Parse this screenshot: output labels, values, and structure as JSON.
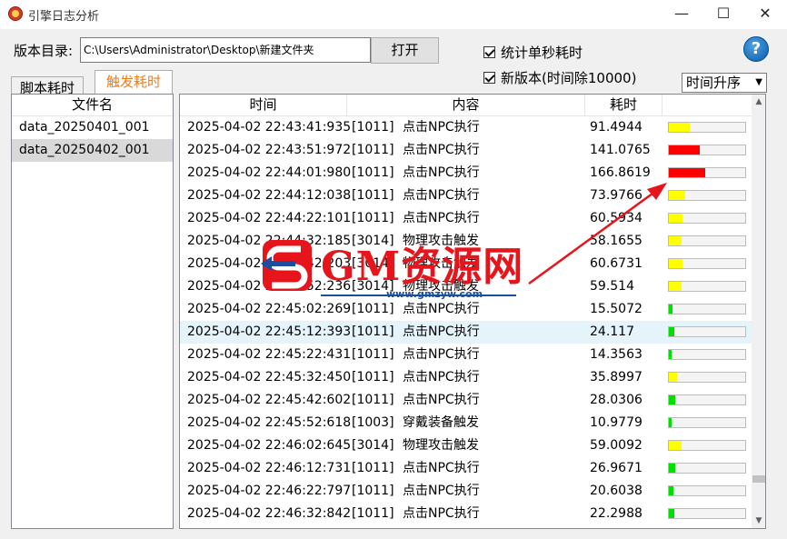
{
  "window": {
    "title": "引擎日志分析",
    "minimize": "—",
    "maximize": "☐",
    "close": "✕"
  },
  "toolbar": {
    "dir_label": "版本目录:",
    "dir_value": "C:\\Users\\Administrator\\Desktop\\新建文件夹",
    "open_label": "打开",
    "stat_per_second": "统计单秒耗时",
    "new_version": "新版本(时间除10000)",
    "help": "?"
  },
  "sort": {
    "value": "时间升序"
  },
  "tabs": [
    {
      "label": "脚本耗时",
      "active": false
    },
    {
      "label": "触发耗时",
      "active": true
    }
  ],
  "file_list": {
    "header": "文件名",
    "items": [
      "data_20250401_001",
      "data_20250402_001"
    ],
    "selected_index": 1
  },
  "table": {
    "headers": {
      "time": "时间",
      "content": "内容",
      "duration": "耗时"
    },
    "highlight_index": 9,
    "rows": [
      {
        "time": "2025-04-02 22:43:41:935",
        "code": "[1011]",
        "name": "点击NPC执行",
        "value": "91.4944",
        "bar": 0.27,
        "color": "#ffff00"
      },
      {
        "time": "2025-04-02 22:43:51:972",
        "code": "[1011]",
        "name": "点击NPC执行",
        "value": "141.0765",
        "bar": 0.41,
        "color": "#ff0000"
      },
      {
        "time": "2025-04-02 22:44:01:980",
        "code": "[1011]",
        "name": "点击NPC执行",
        "value": "166.8619",
        "bar": 0.48,
        "color": "#ff0000"
      },
      {
        "time": "2025-04-02 22:44:12:038",
        "code": "[1011]",
        "name": "点击NPC执行",
        "value": "73.9766",
        "bar": 0.22,
        "color": "#ffff00"
      },
      {
        "time": "2025-04-02 22:44:22:101",
        "code": "[1011]",
        "name": "点击NPC执行",
        "value": "60.5934",
        "bar": 0.18,
        "color": "#ffff00"
      },
      {
        "time": "2025-04-02 22:44:32:185",
        "code": "[3014]",
        "name": "物理攻击触发",
        "value": "58.1655",
        "bar": 0.17,
        "color": "#ffff00"
      },
      {
        "time": "2025-04-02 22:44:42:203",
        "code": "[3014]",
        "name": "物理攻击触发",
        "value": "60.6731",
        "bar": 0.18,
        "color": "#ffff00"
      },
      {
        "time": "2025-04-02 22:44:52:236",
        "code": "[3014]",
        "name": "物理攻击触发",
        "value": "59.514",
        "bar": 0.17,
        "color": "#ffff00"
      },
      {
        "time": "2025-04-02 22:45:02:269",
        "code": "[1011]",
        "name": "点击NPC执行",
        "value": "15.5072",
        "bar": 0.05,
        "color": "#00e000"
      },
      {
        "time": "2025-04-02 22:45:12:393",
        "code": "[1011]",
        "name": "点击NPC执行",
        "value": "24.117",
        "bar": 0.07,
        "color": "#00e000"
      },
      {
        "time": "2025-04-02 22:45:22:431",
        "code": "[1011]",
        "name": "点击NPC执行",
        "value": "14.3563",
        "bar": 0.04,
        "color": "#00e000"
      },
      {
        "time": "2025-04-02 22:45:32:450",
        "code": "[1011]",
        "name": "点击NPC执行",
        "value": "35.8997",
        "bar": 0.11,
        "color": "#ffff00"
      },
      {
        "time": "2025-04-02 22:45:42:602",
        "code": "[1011]",
        "name": "点击NPC执行",
        "value": "28.0306",
        "bar": 0.08,
        "color": "#00e000"
      },
      {
        "time": "2025-04-02 22:45:52:618",
        "code": "[1003]",
        "name": "穿戴装备触发",
        "value": "10.9779",
        "bar": 0.03,
        "color": "#00e000"
      },
      {
        "time": "2025-04-02 22:46:02:645",
        "code": "[3014]",
        "name": "物理攻击触发",
        "value": "59.0092",
        "bar": 0.17,
        "color": "#ffff00"
      },
      {
        "time": "2025-04-02 22:46:12:731",
        "code": "[1011]",
        "name": "点击NPC执行",
        "value": "26.9671",
        "bar": 0.08,
        "color": "#00e000"
      },
      {
        "time": "2025-04-02 22:46:22:797",
        "code": "[1011]",
        "name": "点击NPC执行",
        "value": "20.6038",
        "bar": 0.06,
        "color": "#00e000"
      },
      {
        "time": "2025-04-02 22:46:32:842",
        "code": "[1011]",
        "name": "点击NPC执行",
        "value": "22.2988",
        "bar": 0.07,
        "color": "#00e000"
      }
    ]
  },
  "watermark": {
    "text": "GM资源网",
    "url": "www.gmzyw.com"
  },
  "annotation": {
    "arrow_color": "#e8141b"
  }
}
